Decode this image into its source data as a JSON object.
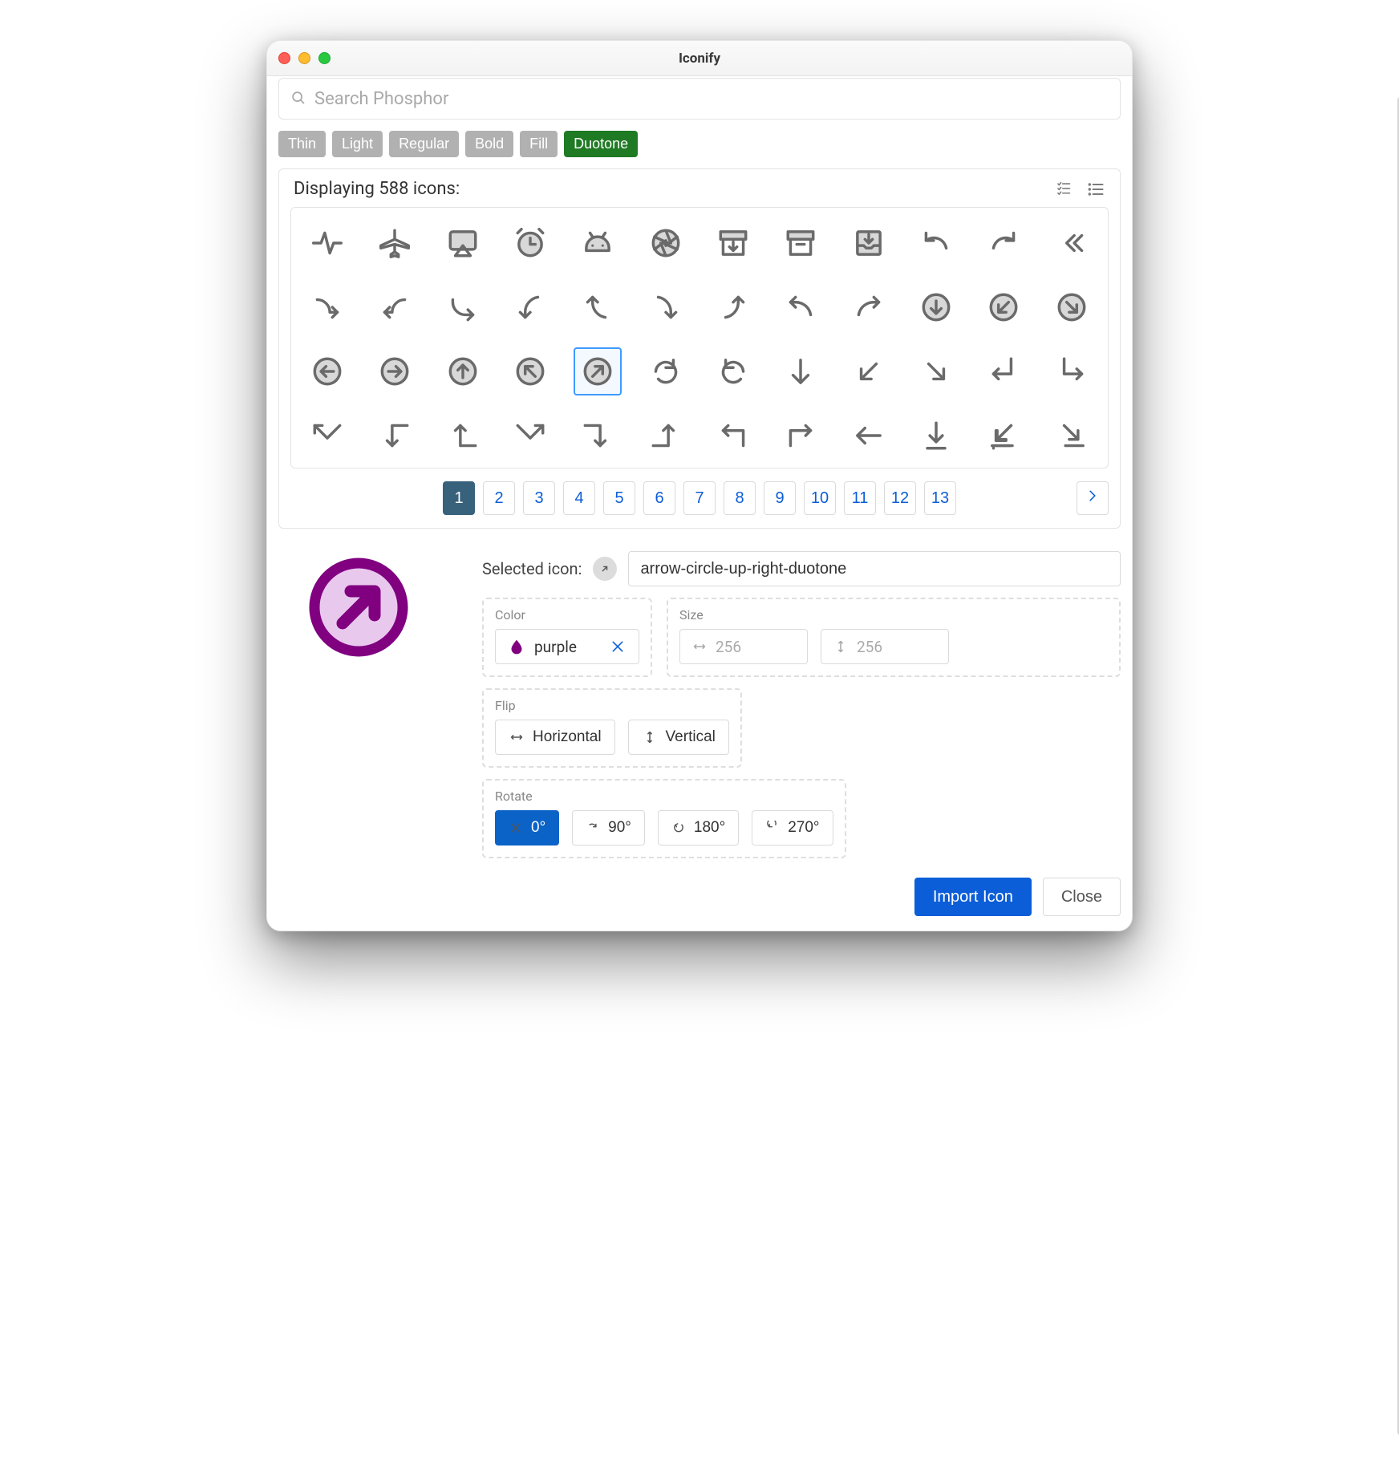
{
  "window": {
    "title": "Iconify"
  },
  "search": {
    "placeholder": "Search Phosphor"
  },
  "filters": [
    "Thin",
    "Light",
    "Regular",
    "Bold",
    "Fill",
    "Duotone"
  ],
  "filters_active_index": 5,
  "results": {
    "label": "Displaying 588 icons:",
    "icons": [
      {
        "name": "activity"
      },
      {
        "name": "airplane"
      },
      {
        "name": "airplay"
      },
      {
        "name": "alarm"
      },
      {
        "name": "android-logo"
      },
      {
        "name": "aperture"
      },
      {
        "name": "archive-box-down"
      },
      {
        "name": "archive"
      },
      {
        "name": "archive-tray"
      },
      {
        "name": "arrow-arc-left"
      },
      {
        "name": "arrow-arc-right"
      },
      {
        "name": "arrows-bend-double-left"
      },
      {
        "name": "arrow-bend-double-right"
      },
      {
        "name": "arrow-bend-down-left"
      },
      {
        "name": "arrow-bend-down-right"
      },
      {
        "name": "arrow-bend-left-down"
      },
      {
        "name": "arrow-bend-left-up"
      },
      {
        "name": "arrow-bend-right-down"
      },
      {
        "name": "arrow-bend-right-up"
      },
      {
        "name": "arrow-bend-up-left"
      },
      {
        "name": "arrow-bend-up-right"
      },
      {
        "name": "arrow-circle-down"
      },
      {
        "name": "arrow-circle-down-left"
      },
      {
        "name": "arrow-circle-down-right"
      },
      {
        "name": "arrow-circle-left"
      },
      {
        "name": "arrow-circle-right"
      },
      {
        "name": "arrow-circle-up"
      },
      {
        "name": "arrow-circle-up-left"
      },
      {
        "name": "arrow-circle-up-right"
      },
      {
        "name": "arrow-clockwise"
      },
      {
        "name": "arrow-counter-clockwise"
      },
      {
        "name": "arrow-down"
      },
      {
        "name": "arrow-down-left"
      },
      {
        "name": "arrow-down-right"
      },
      {
        "name": "arrow-elbow-down-left"
      },
      {
        "name": "arrow-elbow-down-right"
      },
      {
        "name": "arrow-elbow-left"
      },
      {
        "name": "arrow-elbow-left-down"
      },
      {
        "name": "arrow-elbow-left-up"
      },
      {
        "name": "arrow-elbow-right"
      },
      {
        "name": "arrow-elbow-right-down"
      },
      {
        "name": "arrow-elbow-right-up"
      },
      {
        "name": "arrow-elbow-up-left"
      },
      {
        "name": "arrow-elbow-up-right"
      },
      {
        "name": "arrow-left"
      },
      {
        "name": "arrow-line-down"
      },
      {
        "name": "arrow-line-down-left"
      },
      {
        "name": "arrow-line-down-right"
      }
    ],
    "selected_index": 28
  },
  "pagination": {
    "pages": [
      "1",
      "2",
      "3",
      "4",
      "5",
      "6",
      "7",
      "8",
      "9",
      "10",
      "11",
      "12",
      "13"
    ],
    "active_index": 0
  },
  "selection": {
    "label": "Selected icon:",
    "name": "arrow-circle-up-right-duotone",
    "preview_color": "#800080"
  },
  "color": {
    "legend": "Color",
    "value": "purple",
    "swatch": "#800080"
  },
  "size": {
    "legend": "Size",
    "width_placeholder": "256",
    "height_placeholder": "256"
  },
  "flip": {
    "legend": "Flip",
    "horizontal": "Horizontal",
    "vertical": "Vertical"
  },
  "rotate": {
    "legend": "Rotate",
    "options": [
      "0°",
      "90°",
      "180°",
      "270°"
    ],
    "active_index": 0
  },
  "footer": {
    "import": "Import Icon",
    "close": "Close"
  }
}
